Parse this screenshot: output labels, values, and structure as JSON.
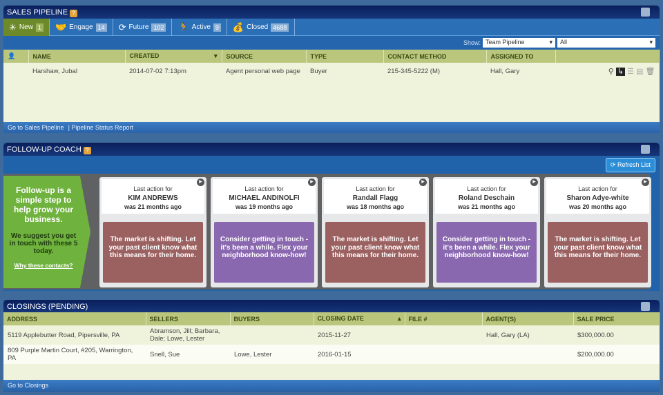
{
  "sales_pipeline": {
    "title": "SALES PIPELINE",
    "help": "?",
    "tabs": [
      {
        "label": "New",
        "count": "1",
        "icon": "✳"
      },
      {
        "label": "Engage",
        "count": "14",
        "icon": "🤝"
      },
      {
        "label": "Future",
        "count": "102",
        "icon": "⟳"
      },
      {
        "label": "Active",
        "count": "9",
        "icon": "🏃"
      },
      {
        "label": "Closed",
        "count": "4688",
        "icon": "💰"
      }
    ],
    "show_label": "Show:",
    "show_value": "Team Pipeline",
    "filter_value": "All",
    "columns": [
      "NAME",
      "CREATED",
      "SOURCE",
      "TYPE",
      "CONTACT METHOD",
      "ASSIGNED TO"
    ],
    "rows": [
      {
        "name": "Harshaw, Jubal",
        "created": "2014-07-02 7:13pm",
        "source": "Agent personal web page",
        "type": "Buyer",
        "contact": "215-345-5222 (M)",
        "assigned": "Hall, Gary"
      }
    ],
    "footer_links": [
      "Go to Sales Pipeline",
      "Pipeline Status Report"
    ]
  },
  "coach": {
    "title": "FOLLOW-UP COACH",
    "help": "?",
    "refresh": "Refresh List",
    "intro_heading": "Follow-up is a simple step to help grow your business.",
    "intro_text": "We suggest you get in touch with these 5 today.",
    "intro_link": "Why these contacts?",
    "cards": [
      {
        "label": "Last action for",
        "name": "KIM ANDREWS",
        "ago": "was 21 months ago",
        "message": "The market is shifting. Let your past client know what this means for their home.",
        "color": "#9b6060"
      },
      {
        "label": "Last action for",
        "name": "MICHAEL ANDINOLFI",
        "ago": "was 19 months ago",
        "message": "Consider getting in touch - it's been a while. Flex your neighborhood know-how!",
        "color": "#8a68b0"
      },
      {
        "label": "Last action for",
        "name": "Randall Flagg",
        "ago": "was 18 months ago",
        "message": "The market is shifting. Let your past client know what this means for their home.",
        "color": "#9b6060"
      },
      {
        "label": "Last action for",
        "name": "Roland Deschain",
        "ago": "was 21 months ago",
        "message": "Consider getting in touch - it's been a while. Flex your neighborhood know-how!",
        "color": "#8a68b0"
      },
      {
        "label": "Last action for",
        "name": "Sharon Adye-white",
        "ago": "was 20 months ago",
        "message": "The market is shifting. Let your past client know what this means for their home.",
        "color": "#9b6060"
      }
    ]
  },
  "closings": {
    "title": "CLOSINGS (PENDING)",
    "columns": [
      "ADDRESS",
      "SELLERS",
      "BUYERS",
      "CLOSING DATE",
      "FILE #",
      "AGENT(S)",
      "SALE PRICE"
    ],
    "rows": [
      {
        "address": "5119 Applebutter Road, Pipersville, PA",
        "sellers": "Abramson, Jill; Barbara, Dale; Lowe, Lester",
        "buyers": "",
        "date": "2015-11-27",
        "file": "",
        "agents": "Hall, Gary (LA)",
        "price": "$300,000.00"
      },
      {
        "address": "809 Purple Martin Court, #205, Warrington, PA",
        "sellers": "Snell, Sue",
        "buyers": "Lowe, Lester",
        "date": "2016-01-15",
        "file": "",
        "agents": "",
        "price": "$200,000.00"
      }
    ],
    "footer_link": "Go to Closings"
  }
}
